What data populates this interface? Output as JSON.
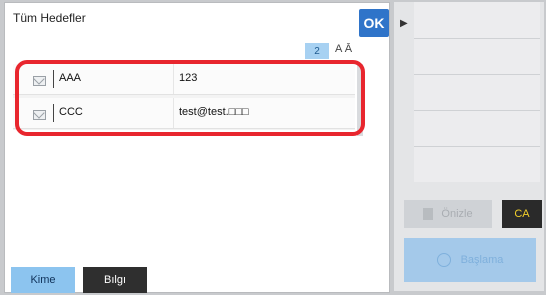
{
  "header": {
    "title": "Tüm Hedefler",
    "ok_label": "OK",
    "count_badge": "2",
    "sort_label": "A Ā"
  },
  "address_list": [
    {
      "name": "AAA",
      "value": "123"
    },
    {
      "name": "CCC",
      "value": "test@test.□□□"
    }
  ],
  "tabs": {
    "to_label": "Kime",
    "info_label": "Bılgı"
  },
  "right_panel": {
    "preview_label": "Önizle",
    "ca_label": "CA",
    "start_label": "Başlama"
  },
  "colors": {
    "accent": "#2f74c9",
    "highlight": "#e8262e",
    "ca_text": "#f2cf2b"
  }
}
